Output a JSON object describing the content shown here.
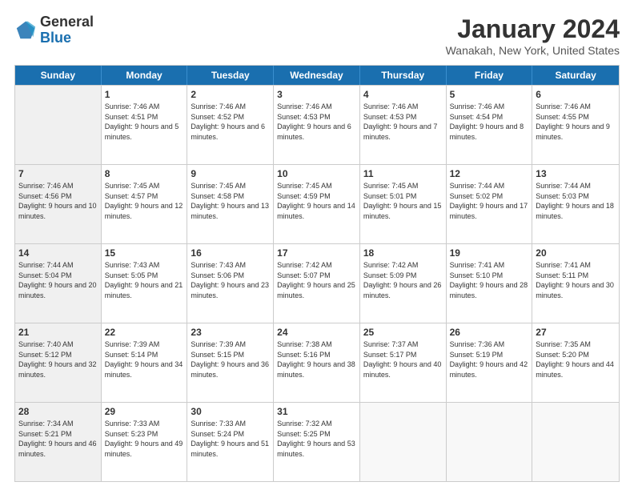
{
  "header": {
    "logo_line1": "General",
    "logo_line2": "Blue",
    "month": "January 2024",
    "location": "Wanakah, New York, United States"
  },
  "weekdays": [
    "Sunday",
    "Monday",
    "Tuesday",
    "Wednesday",
    "Thursday",
    "Friday",
    "Saturday"
  ],
  "rows": [
    [
      {
        "day": "",
        "sunrise": "",
        "sunset": "",
        "daylight": "",
        "shaded": true
      },
      {
        "day": "1",
        "sunrise": "Sunrise: 7:46 AM",
        "sunset": "Sunset: 4:51 PM",
        "daylight": "Daylight: 9 hours and 5 minutes.",
        "shaded": false
      },
      {
        "day": "2",
        "sunrise": "Sunrise: 7:46 AM",
        "sunset": "Sunset: 4:52 PM",
        "daylight": "Daylight: 9 hours and 6 minutes.",
        "shaded": false
      },
      {
        "day": "3",
        "sunrise": "Sunrise: 7:46 AM",
        "sunset": "Sunset: 4:53 PM",
        "daylight": "Daylight: 9 hours and 6 minutes.",
        "shaded": false
      },
      {
        "day": "4",
        "sunrise": "Sunrise: 7:46 AM",
        "sunset": "Sunset: 4:53 PM",
        "daylight": "Daylight: 9 hours and 7 minutes.",
        "shaded": false
      },
      {
        "day": "5",
        "sunrise": "Sunrise: 7:46 AM",
        "sunset": "Sunset: 4:54 PM",
        "daylight": "Daylight: 9 hours and 8 minutes.",
        "shaded": false
      },
      {
        "day": "6",
        "sunrise": "Sunrise: 7:46 AM",
        "sunset": "Sunset: 4:55 PM",
        "daylight": "Daylight: 9 hours and 9 minutes.",
        "shaded": false
      }
    ],
    [
      {
        "day": "7",
        "sunrise": "Sunrise: 7:46 AM",
        "sunset": "Sunset: 4:56 PM",
        "daylight": "Daylight: 9 hours and 10 minutes.",
        "shaded": true
      },
      {
        "day": "8",
        "sunrise": "Sunrise: 7:45 AM",
        "sunset": "Sunset: 4:57 PM",
        "daylight": "Daylight: 9 hours and 12 minutes.",
        "shaded": false
      },
      {
        "day": "9",
        "sunrise": "Sunrise: 7:45 AM",
        "sunset": "Sunset: 4:58 PM",
        "daylight": "Daylight: 9 hours and 13 minutes.",
        "shaded": false
      },
      {
        "day": "10",
        "sunrise": "Sunrise: 7:45 AM",
        "sunset": "Sunset: 4:59 PM",
        "daylight": "Daylight: 9 hours and 14 minutes.",
        "shaded": false
      },
      {
        "day": "11",
        "sunrise": "Sunrise: 7:45 AM",
        "sunset": "Sunset: 5:01 PM",
        "daylight": "Daylight: 9 hours and 15 minutes.",
        "shaded": false
      },
      {
        "day": "12",
        "sunrise": "Sunrise: 7:44 AM",
        "sunset": "Sunset: 5:02 PM",
        "daylight": "Daylight: 9 hours and 17 minutes.",
        "shaded": false
      },
      {
        "day": "13",
        "sunrise": "Sunrise: 7:44 AM",
        "sunset": "Sunset: 5:03 PM",
        "daylight": "Daylight: 9 hours and 18 minutes.",
        "shaded": false
      }
    ],
    [
      {
        "day": "14",
        "sunrise": "Sunrise: 7:44 AM",
        "sunset": "Sunset: 5:04 PM",
        "daylight": "Daylight: 9 hours and 20 minutes.",
        "shaded": true
      },
      {
        "day": "15",
        "sunrise": "Sunrise: 7:43 AM",
        "sunset": "Sunset: 5:05 PM",
        "daylight": "Daylight: 9 hours and 21 minutes.",
        "shaded": false
      },
      {
        "day": "16",
        "sunrise": "Sunrise: 7:43 AM",
        "sunset": "Sunset: 5:06 PM",
        "daylight": "Daylight: 9 hours and 23 minutes.",
        "shaded": false
      },
      {
        "day": "17",
        "sunrise": "Sunrise: 7:42 AM",
        "sunset": "Sunset: 5:07 PM",
        "daylight": "Daylight: 9 hours and 25 minutes.",
        "shaded": false
      },
      {
        "day": "18",
        "sunrise": "Sunrise: 7:42 AM",
        "sunset": "Sunset: 5:09 PM",
        "daylight": "Daylight: 9 hours and 26 minutes.",
        "shaded": false
      },
      {
        "day": "19",
        "sunrise": "Sunrise: 7:41 AM",
        "sunset": "Sunset: 5:10 PM",
        "daylight": "Daylight: 9 hours and 28 minutes.",
        "shaded": false
      },
      {
        "day": "20",
        "sunrise": "Sunrise: 7:41 AM",
        "sunset": "Sunset: 5:11 PM",
        "daylight": "Daylight: 9 hours and 30 minutes.",
        "shaded": false
      }
    ],
    [
      {
        "day": "21",
        "sunrise": "Sunrise: 7:40 AM",
        "sunset": "Sunset: 5:12 PM",
        "daylight": "Daylight: 9 hours and 32 minutes.",
        "shaded": true
      },
      {
        "day": "22",
        "sunrise": "Sunrise: 7:39 AM",
        "sunset": "Sunset: 5:14 PM",
        "daylight": "Daylight: 9 hours and 34 minutes.",
        "shaded": false
      },
      {
        "day": "23",
        "sunrise": "Sunrise: 7:39 AM",
        "sunset": "Sunset: 5:15 PM",
        "daylight": "Daylight: 9 hours and 36 minutes.",
        "shaded": false
      },
      {
        "day": "24",
        "sunrise": "Sunrise: 7:38 AM",
        "sunset": "Sunset: 5:16 PM",
        "daylight": "Daylight: 9 hours and 38 minutes.",
        "shaded": false
      },
      {
        "day": "25",
        "sunrise": "Sunrise: 7:37 AM",
        "sunset": "Sunset: 5:17 PM",
        "daylight": "Daylight: 9 hours and 40 minutes.",
        "shaded": false
      },
      {
        "day": "26",
        "sunrise": "Sunrise: 7:36 AM",
        "sunset": "Sunset: 5:19 PM",
        "daylight": "Daylight: 9 hours and 42 minutes.",
        "shaded": false
      },
      {
        "day": "27",
        "sunrise": "Sunrise: 7:35 AM",
        "sunset": "Sunset: 5:20 PM",
        "daylight": "Daylight: 9 hours and 44 minutes.",
        "shaded": false
      }
    ],
    [
      {
        "day": "28",
        "sunrise": "Sunrise: 7:34 AM",
        "sunset": "Sunset: 5:21 PM",
        "daylight": "Daylight: 9 hours and 46 minutes.",
        "shaded": true
      },
      {
        "day": "29",
        "sunrise": "Sunrise: 7:33 AM",
        "sunset": "Sunset: 5:23 PM",
        "daylight": "Daylight: 9 hours and 49 minutes.",
        "shaded": false
      },
      {
        "day": "30",
        "sunrise": "Sunrise: 7:33 AM",
        "sunset": "Sunset: 5:24 PM",
        "daylight": "Daylight: 9 hours and 51 minutes.",
        "shaded": false
      },
      {
        "day": "31",
        "sunrise": "Sunrise: 7:32 AM",
        "sunset": "Sunset: 5:25 PM",
        "daylight": "Daylight: 9 hours and 53 minutes.",
        "shaded": false
      },
      {
        "day": "",
        "sunrise": "",
        "sunset": "",
        "daylight": "",
        "shaded": false
      },
      {
        "day": "",
        "sunrise": "",
        "sunset": "",
        "daylight": "",
        "shaded": false
      },
      {
        "day": "",
        "sunrise": "",
        "sunset": "",
        "daylight": "",
        "shaded": false
      }
    ]
  ]
}
